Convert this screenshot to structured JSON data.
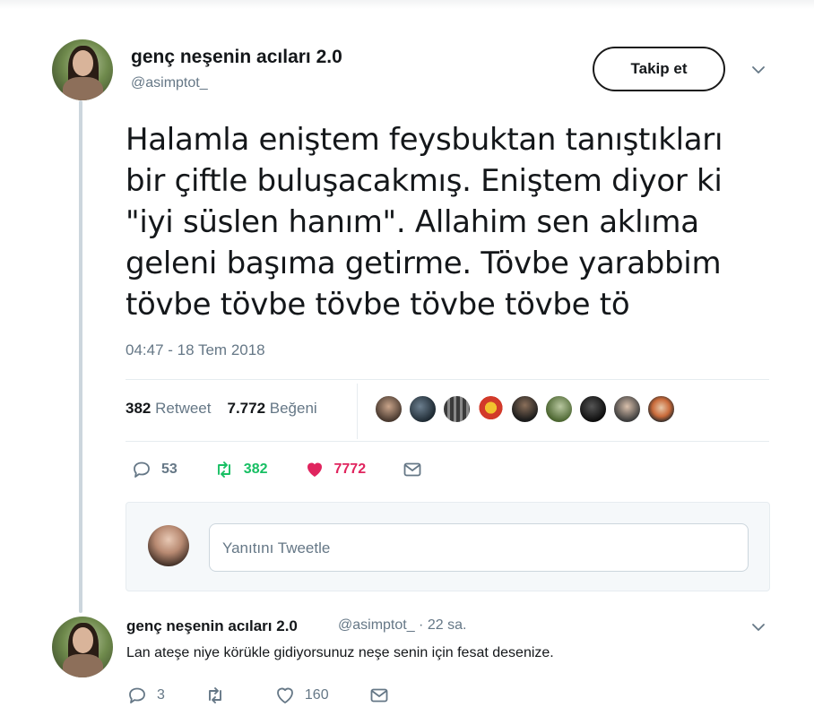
{
  "tweet": {
    "author_name": "genç neşenin acıları 2.0",
    "author_handle": "@asimptot_",
    "follow_label": "Takip et",
    "text_lines": [
      "Halamla eniştem feysbuktan tanıştıkları",
      "bir çiftle buluşacakmış. Eniştem diyor ki",
      "\"iyi süslen hanım\". Allahim sen aklıma",
      "geleni başıma getirme. Tövbe yarabbim",
      "tövbe tövbe tövbe tövbe tövbe tö"
    ],
    "timestamp": "04:47 - 18 Tem 2018",
    "retweet_count": "382",
    "retweet_label": "Retweet",
    "like_count": "7.772",
    "like_label": "Beğeni",
    "actions": {
      "replies": "53",
      "retweets": "382",
      "likes": "7772"
    }
  },
  "reply_box": {
    "placeholder": "Yanıtını Tweetle"
  },
  "reply": {
    "author_name": "genç neşenin acıları 2.0",
    "author_handle": "@asimptot_ · 22 sa.",
    "text": "Lan ateşe niye körükle gidiyorsunuz neşe senin için fesat desenize.",
    "actions": {
      "replies": "3",
      "retweets": "",
      "likes": "160"
    }
  },
  "colors": {
    "retweet_green": "#17bf63",
    "like_red": "#e0245e",
    "muted": "#657786",
    "text": "#14171a"
  },
  "icons": [
    "reply-icon",
    "retweet-icon",
    "heart-icon",
    "message-icon",
    "chevron-down-icon"
  ]
}
